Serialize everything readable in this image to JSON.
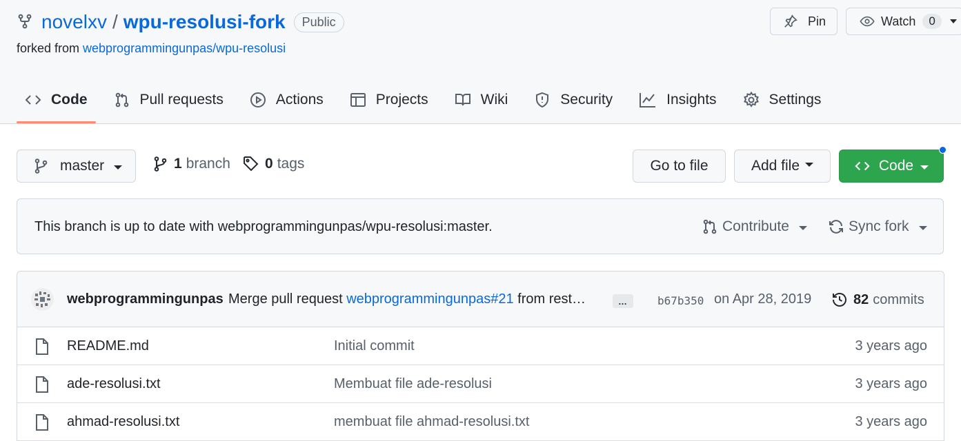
{
  "repo": {
    "owner": "novelxv",
    "separator": "/",
    "name": "wpu-resolusi-fork",
    "visibility": "Public",
    "forked_from_prefix": "forked from ",
    "forked_from": "webprogrammingunpas/wpu-resolusi"
  },
  "actions": {
    "pin_label": "Pin",
    "watch_label": "Watch",
    "watch_count": "0"
  },
  "tabs": [
    {
      "label": "Code",
      "icon": "code-icon",
      "selected": true
    },
    {
      "label": "Pull requests",
      "icon": "pull-request-icon"
    },
    {
      "label": "Actions",
      "icon": "play-icon"
    },
    {
      "label": "Projects",
      "icon": "table-icon"
    },
    {
      "label": "Wiki",
      "icon": "book-icon"
    },
    {
      "label": "Security",
      "icon": "shield-icon"
    },
    {
      "label": "Insights",
      "icon": "graph-icon"
    },
    {
      "label": "Settings",
      "icon": "gear-icon"
    }
  ],
  "file_nav": {
    "branch": "master",
    "branch_count": "1",
    "branch_label": "branch",
    "tag_count": "0",
    "tag_label": "tags",
    "go_to_file": "Go to file",
    "add_file": "Add file",
    "code": "Code"
  },
  "branch_status": {
    "text": "This branch is up to date with webprogrammingunpas/wpu-resolusi:master.",
    "contribute": "Contribute",
    "sync_fork": "Sync fork"
  },
  "latest_commit": {
    "author": "webprogrammingunpas",
    "message_prefix": "Merge pull request ",
    "pr_ref": "webprogrammingunpas#21",
    "message_suffix": " from rest…",
    "ellipsis": "…",
    "sha": "b67b350",
    "date": "on Apr 28, 2019",
    "commit_count": "82",
    "commit_label": "commits"
  },
  "files": [
    {
      "name": "README.md",
      "message": "Initial commit",
      "age": "3 years ago"
    },
    {
      "name": "ade-resolusi.txt",
      "message": "Membuat file ade-resolusi",
      "age": "3 years ago"
    },
    {
      "name": "ahmad-resolusi.txt",
      "message": "membuat file ahmad-resolusi.txt",
      "age": "3 years ago"
    }
  ],
  "colors": {
    "link": "#0969da",
    "primary_button": "#2da44e",
    "selected_tab_underline": "#fd8c73",
    "notification_dot": "#0969da"
  }
}
